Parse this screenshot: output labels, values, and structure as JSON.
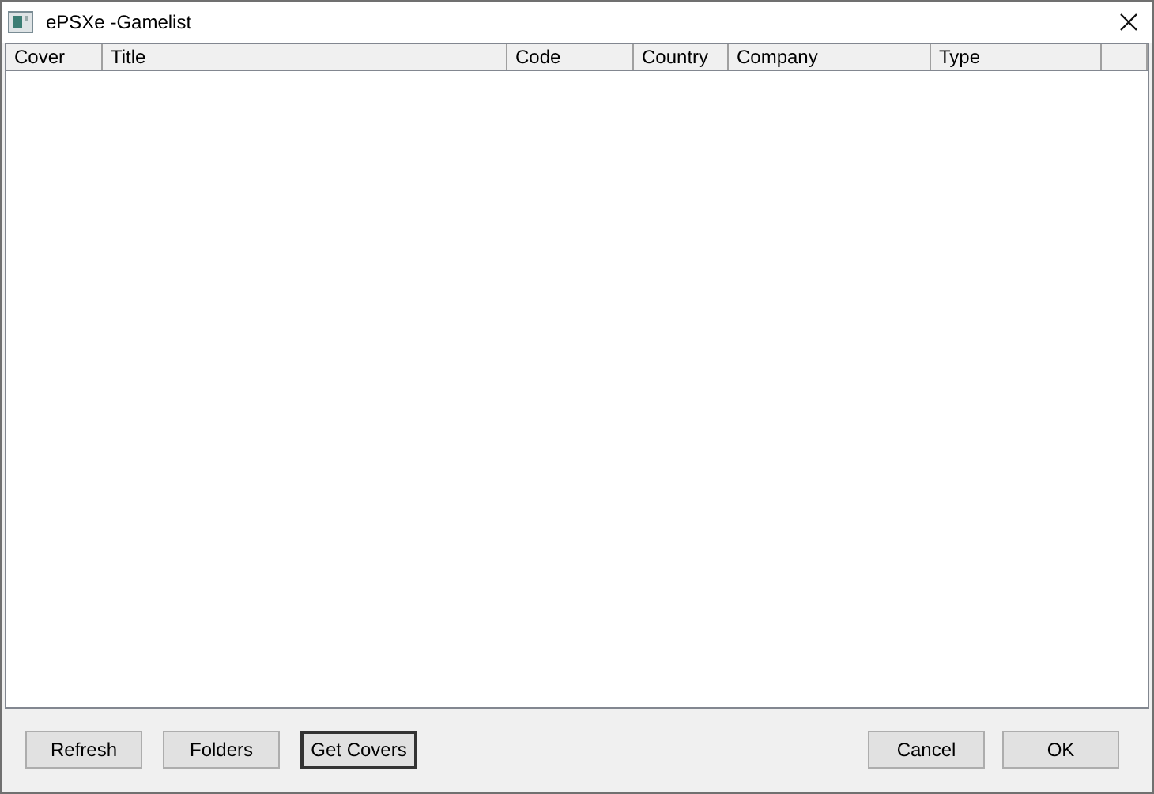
{
  "window": {
    "title": "ePSXe -Gamelist"
  },
  "table": {
    "columns": [
      {
        "label": "Cover"
      },
      {
        "label": "Title"
      },
      {
        "label": "Code"
      },
      {
        "label": "Country"
      },
      {
        "label": "Company"
      },
      {
        "label": "Type"
      }
    ]
  },
  "buttons_left": [
    {
      "label": "Refresh",
      "focused": false
    },
    {
      "label": "Folders",
      "focused": false
    },
    {
      "label": "Get Covers",
      "focused": true
    }
  ],
  "buttons_right": [
    {
      "label": "Cancel",
      "focused": false
    },
    {
      "label": "OK",
      "focused": false
    }
  ]
}
